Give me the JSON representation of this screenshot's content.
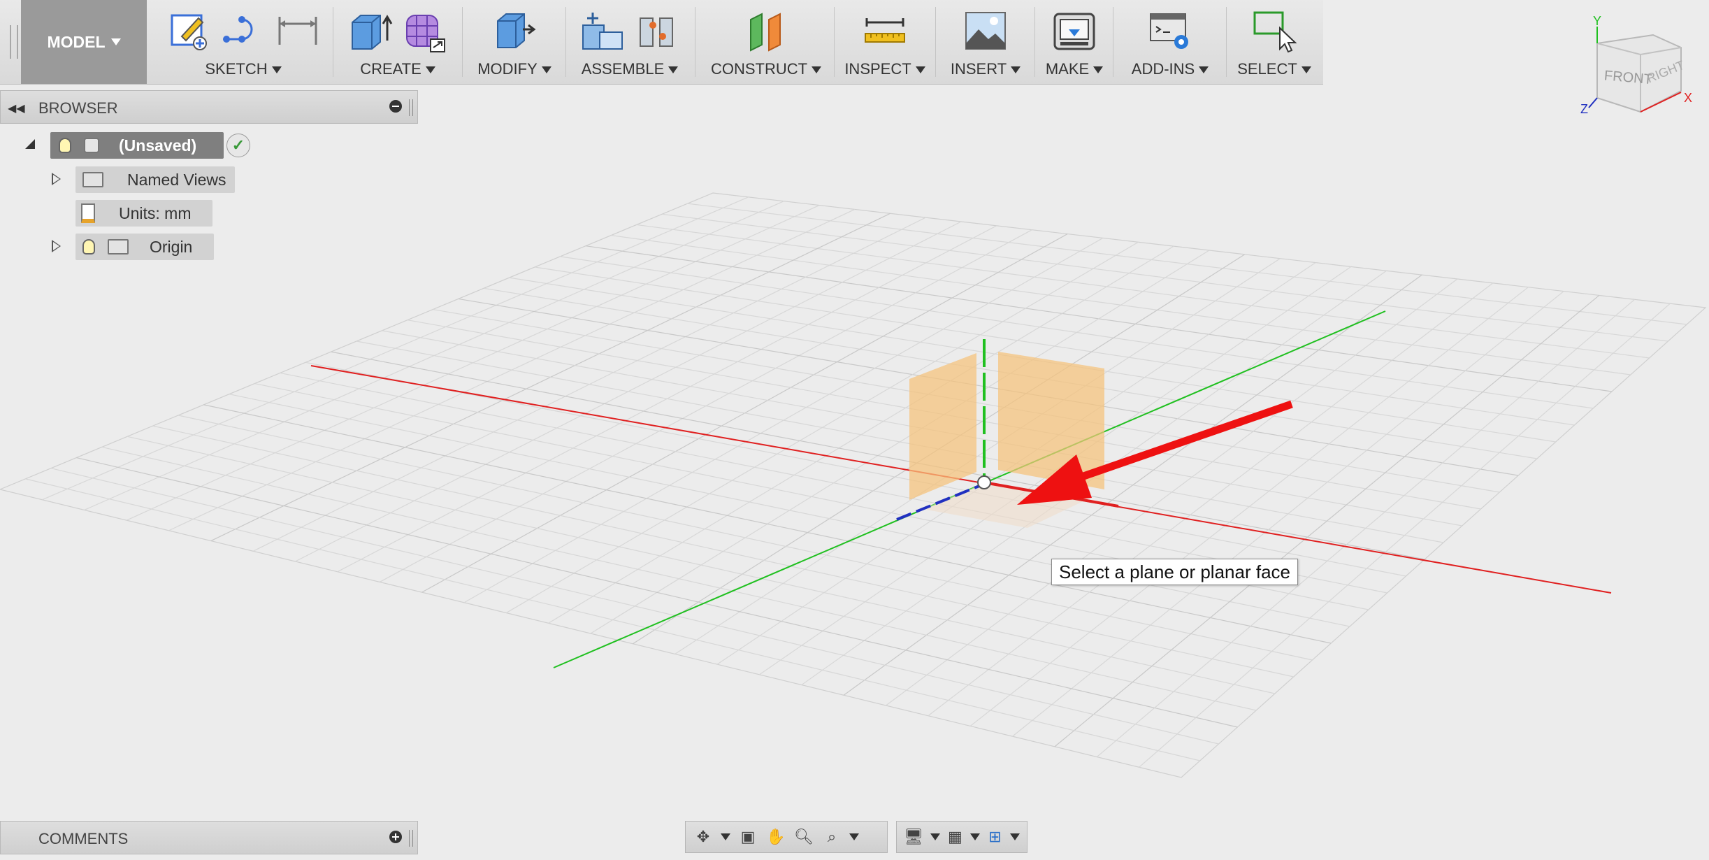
{
  "toolbar": {
    "workspace": "MODEL",
    "groups": {
      "sketch": "SKETCH",
      "create": "CREATE",
      "modify": "MODIFY",
      "assemble": "ASSEMBLE",
      "construct": "CONSTRUCT",
      "inspect": "INSPECT",
      "insert": "INSERT",
      "make": "MAKE",
      "addins": "ADD-INS",
      "select": "SELECT"
    }
  },
  "browser": {
    "title": "BROWSER",
    "root": "(Unsaved)",
    "items": [
      {
        "label": "Named Views"
      },
      {
        "label": "Units: mm"
      },
      {
        "label": "Origin"
      }
    ]
  },
  "comments": {
    "title": "COMMENTS"
  },
  "viewcube": {
    "front": "FRONT",
    "right": "RIGHT",
    "x": "X",
    "y": "Y",
    "z": "Z"
  },
  "tooltip": "Select a plane or planar face",
  "colors": {
    "x_axis": "#e02020",
    "y_axis": "#20c020",
    "z_axis": "#2030c0",
    "plane": "#f5c27a",
    "arrow": "#ee1111"
  }
}
